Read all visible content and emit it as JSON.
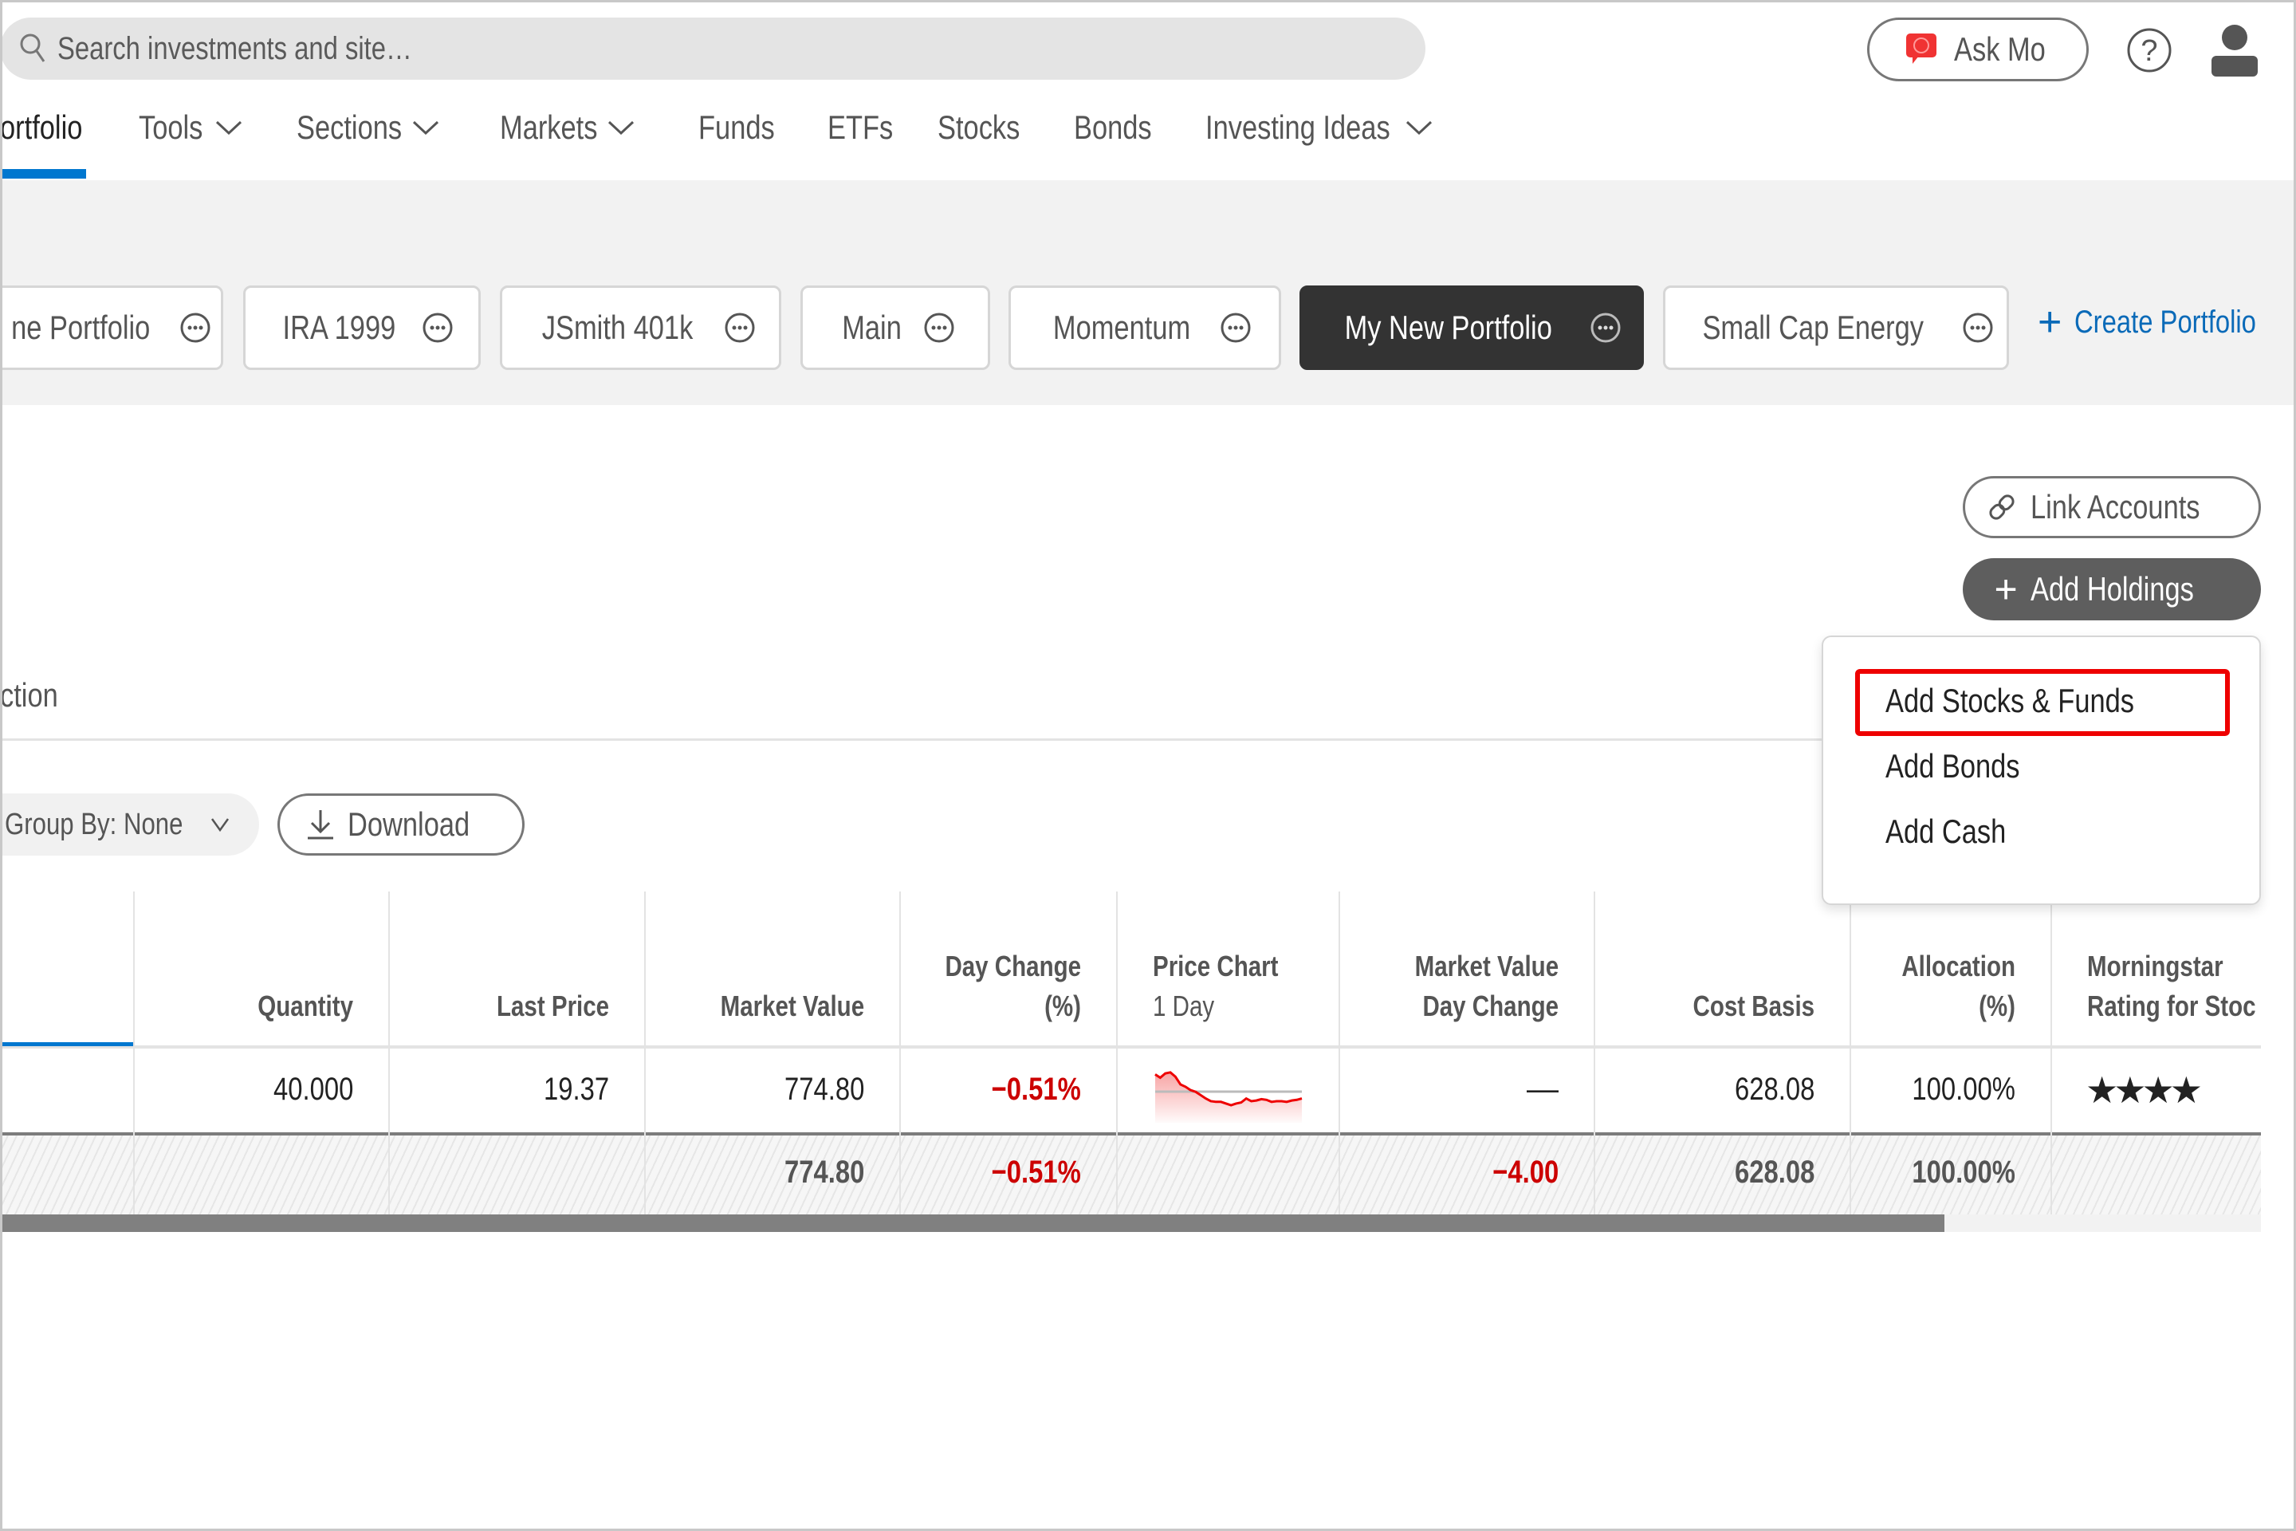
{
  "header": {
    "search_placeholder": "Search investments and site…",
    "ask_mo_label": "Ask Mo",
    "icons": [
      "search-icon",
      "chat-bubble-icon",
      "help-icon",
      "user-icon"
    ]
  },
  "nav": {
    "items": [
      {
        "label": "ortfolio",
        "active": true,
        "has_dropdown": false
      },
      {
        "label": "Tools",
        "has_dropdown": true
      },
      {
        "label": "Sections",
        "has_dropdown": true
      },
      {
        "label": "Markets",
        "has_dropdown": true
      },
      {
        "label": "Funds",
        "has_dropdown": false
      },
      {
        "label": "ETFs",
        "has_dropdown": false
      },
      {
        "label": "Stocks",
        "has_dropdown": false
      },
      {
        "label": "Bonds",
        "has_dropdown": false
      },
      {
        "label": "Investing Ideas",
        "has_dropdown": true
      }
    ]
  },
  "portfolios": {
    "chips": [
      {
        "label": "ne Portfolio"
      },
      {
        "label": "IRA 1999"
      },
      {
        "label": "JSmith 401k"
      },
      {
        "label": "Main"
      },
      {
        "label": "Momentum"
      },
      {
        "label": "My New Portfolio",
        "active": true
      },
      {
        "label": "Small Cap Energy"
      }
    ],
    "create_label": "Create Portfolio"
  },
  "actions": {
    "link_accounts": "Link Accounts",
    "add_holdings": "Add Holdings",
    "dropdown": [
      "Add Stocks & Funds",
      "Add Bonds",
      "Add Cash"
    ],
    "highlighted_item": "Add Stocks & Funds"
  },
  "section_label": "ction",
  "toolbar": {
    "group_by": "Group By: None",
    "download": "Download"
  },
  "table": {
    "columns": [
      {
        "line1": "Quantity",
        "line2": ""
      },
      {
        "line1": "Last Price",
        "line2": ""
      },
      {
        "line1": "Market Value",
        "line2": ""
      },
      {
        "line1": "Day Change",
        "line2": "(%)"
      },
      {
        "line1": "Price Chart",
        "line2": "1 Day"
      },
      {
        "line1": "Market Value",
        "line2": "Day Change"
      },
      {
        "line1": "Cost Basis",
        "line2": ""
      },
      {
        "line1": "Allocation",
        "line2": "(%)"
      },
      {
        "line1": "Morningstar",
        "line2": "Rating for Stoc"
      }
    ],
    "row": {
      "quantity": "40.000",
      "last_price": "19.37",
      "market_value": "774.80",
      "day_change_pct": "−0.51%",
      "mv_day_change": "—",
      "cost_basis": "628.08",
      "allocation": "100.00%",
      "rating": "★★★★",
      "rating_stars": 4,
      "sparkline": [
        0.92,
        0.82,
        0.95,
        0.98,
        0.85,
        0.62,
        0.55,
        0.45,
        0.4,
        0.3,
        0.2,
        0.12,
        0.1,
        0.1,
        0.05,
        0.0,
        0.05,
        0.08,
        0.2,
        0.12,
        0.14,
        0.18,
        0.16,
        0.1,
        0.12,
        0.12,
        0.1,
        0.14,
        0.16,
        0.2
      ]
    },
    "total": {
      "market_value": "774.80",
      "day_change_pct": "−0.51%",
      "mv_day_change": "−4.00",
      "cost_basis": "628.08",
      "allocation": "100.00%"
    },
    "scroll_fraction": 0.86
  },
  "colors": {
    "accent_blue": "#0077cf",
    "negative_red": "#cc0000",
    "highlight_red": "#ee0000",
    "active_chip": "#333333",
    "primary_button": "#5e5e5e"
  }
}
